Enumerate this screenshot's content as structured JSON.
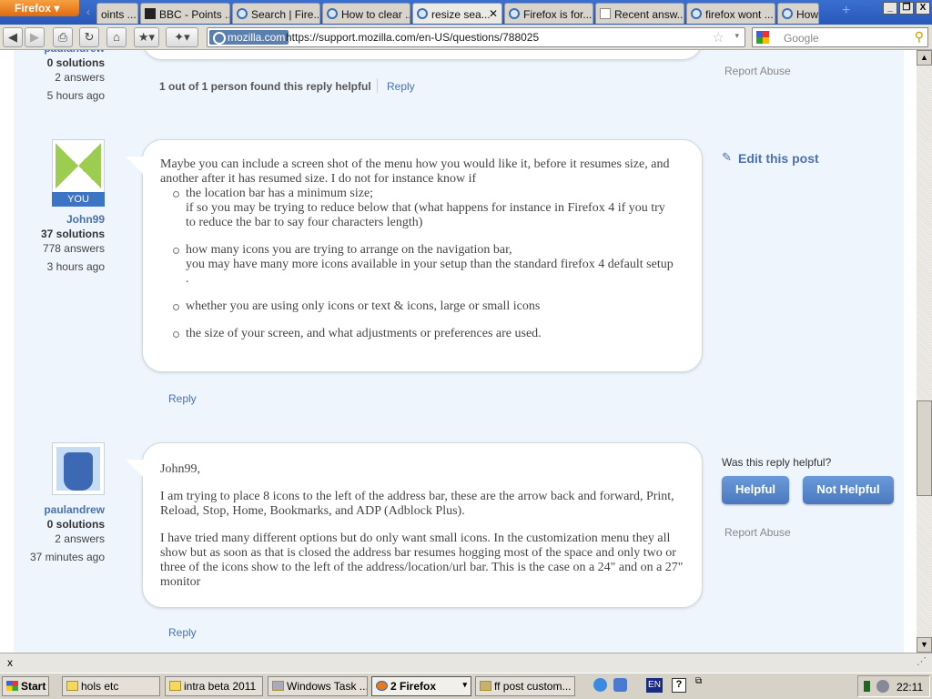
{
  "browser": {
    "menu_button": "Firefox",
    "tabs": [
      {
        "title": "oints ..."
      },
      {
        "title": "BBC - Points ..."
      },
      {
        "title": "Search | Fire..."
      },
      {
        "title": "How to clear ..."
      },
      {
        "title": "resize sea...",
        "active": true
      },
      {
        "title": "Firefox is for..."
      },
      {
        "title": "Recent answ..."
      },
      {
        "title": "firefox wont ..."
      },
      {
        "title": "How"
      }
    ],
    "identity": "mozilla.com",
    "url": "https://support.mozilla.com/en-US/questions/788025",
    "search_placeholder": "Google"
  },
  "posts": [
    {
      "user": "paulandrew",
      "solutions": "0 solutions",
      "answers": "2 answers",
      "time": "5 hours ago",
      "helpful_count": "1 out of 1 person found this reply helpful",
      "reply": "Reply",
      "report": "Report Abuse"
    },
    {
      "user": "John99",
      "badge": "YOU",
      "solutions": "37 solutions",
      "answers": "778 answers",
      "time": "3 hours ago",
      "intro": "Maybe you can include a screen shot of the menu how you would like it, before it resumes size, and another after it has resumed size. I do not for instance know if",
      "bullets": [
        {
          "line1": "the location bar has a minimum size;",
          "line2": "if so you may be trying to reduce below that (what happens for instance in Firefox 4 if you try to reduce the bar to say four characters length)"
        },
        {
          "line1": "how many icons you are trying to arrange on the navigation bar,",
          "line2": "you may have many more icons available in your setup than the standard firefox 4 default setup ."
        },
        {
          "line1": "whether you are using only icons or text & icons, large or small icons",
          "line2": ""
        },
        {
          "line1": "the size of your screen, and what adjustments or preferences are used.",
          "line2": ""
        }
      ],
      "edit": "Edit this post",
      "reply": "Reply"
    },
    {
      "user": "paulandrew",
      "solutions": "0 solutions",
      "answers": "2 answers",
      "time": "37 minutes ago",
      "p1": "John99,",
      "p2": "I am trying to place 8 icons to the left of the address bar, these are the arrow back and forward, Print, Reload, Stop, Home, Bookmarks, and ADP (Adblock Plus).",
      "p3": "I have tried many different options but do only want small icons. In the customization menu they all show but as soon as that is closed the address bar resumes hogging most of the space and only two or three of the icons show to the left of the address/location/url bar. This is the case on a 24\" and on a 27\" monitor",
      "question": "Was this reply helpful?",
      "helpful": "Helpful",
      "not_helpful": "Not Helpful",
      "report": "Report Abuse",
      "reply": "Reply"
    }
  ],
  "findbar": {
    "close": "x"
  },
  "taskbar": {
    "start": "Start",
    "items": [
      {
        "label": "hols etc"
      },
      {
        "label": "intra beta 2011"
      },
      {
        "label": "Windows Task ..."
      },
      {
        "label": "2 Firefox"
      },
      {
        "label": "ff post custom..."
      }
    ],
    "lang": "EN",
    "clock": "22:11"
  }
}
